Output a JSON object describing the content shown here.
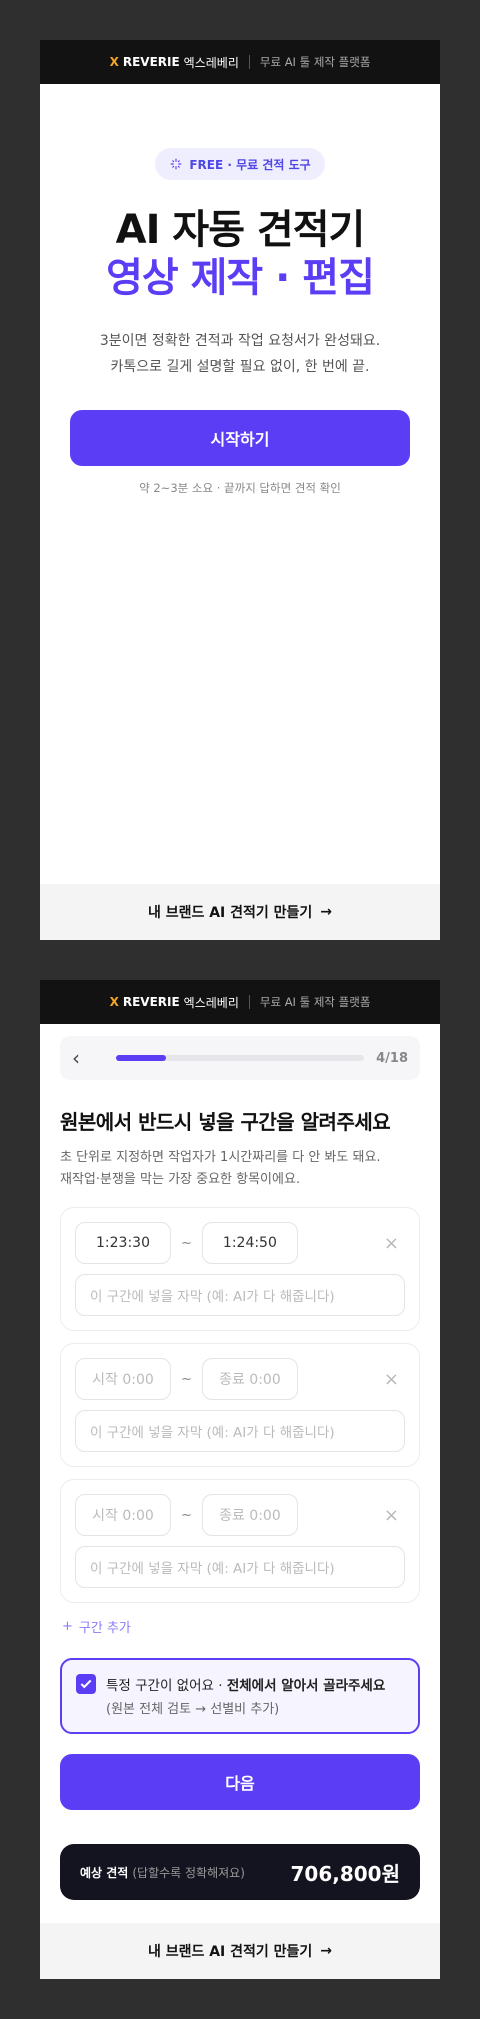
{
  "topbar": {
    "brand_x": "X",
    "brand_name": "REVERIE",
    "brand_kr": "엑스레베리",
    "desc": "무료 AI 툴 제작 플랫폼"
  },
  "intro": {
    "pill": "FREE · 무료 견적 도구",
    "title_line1": "AI 자동 견적기",
    "title_line2": "영상 제작 · 편집",
    "lead_line1": "3분이면 정확한 견적과 작업 요청서가 완성돼요.",
    "lead_line2": "카톡으로 길게 설명할 필요 없이, 한 번에 끝.",
    "cta": "시작하기",
    "hint": "약 2~3분 소요 · 끝까지 답하면 견적 확인"
  },
  "footer": {
    "label": "내 브랜드 AI 견적기 만들기",
    "arrow": "→"
  },
  "progress": {
    "step": "4/18",
    "fraction": 0.2
  },
  "question": {
    "title": "원본에서 반드시 넣을 구간을 알려주세요",
    "desc_line1": "초 단위로 지정하면 작업자가 1시간짜리를 다 안 봐도 돼요.",
    "desc_line2": "재작업·분쟁을 막는 가장 중요한 항목이에요."
  },
  "segments": [
    {
      "start": "1:23:30",
      "end": "1:24:50",
      "filled": true,
      "subtitle_placeholder": "이 구간에 넣을 자막 (예: AI가 다 해줍니다)"
    },
    {
      "start": "시작 0:00",
      "end": "종료 0:00",
      "filled": false,
      "subtitle_placeholder": "이 구간에 넣을 자막 (예: AI가 다 해줍니다)"
    },
    {
      "start": "시작 0:00",
      "end": "종료 0:00",
      "filled": false,
      "subtitle_placeholder": "이 구간에 넣을 자막 (예: AI가 다 해줍니다)"
    }
  ],
  "range_sep": "~",
  "add_segment": "구간 추가",
  "auto_pick": {
    "text_plain": "특정 구간이 없어요 · ",
    "text_bold": "전체에서 알아서 골라주세요",
    "sub": "(원본 전체 검토 → 선별비 추가)",
    "checked": true
  },
  "next_button": "다음",
  "estimate": {
    "label": "예상 견적",
    "note": "(답할수록 정확해져요)",
    "price": "706,800원"
  },
  "colors": {
    "accent": "#5b3df5",
    "topbar": "#121212",
    "brand_x": "#f5a623",
    "estimate_bg": "#141421"
  }
}
